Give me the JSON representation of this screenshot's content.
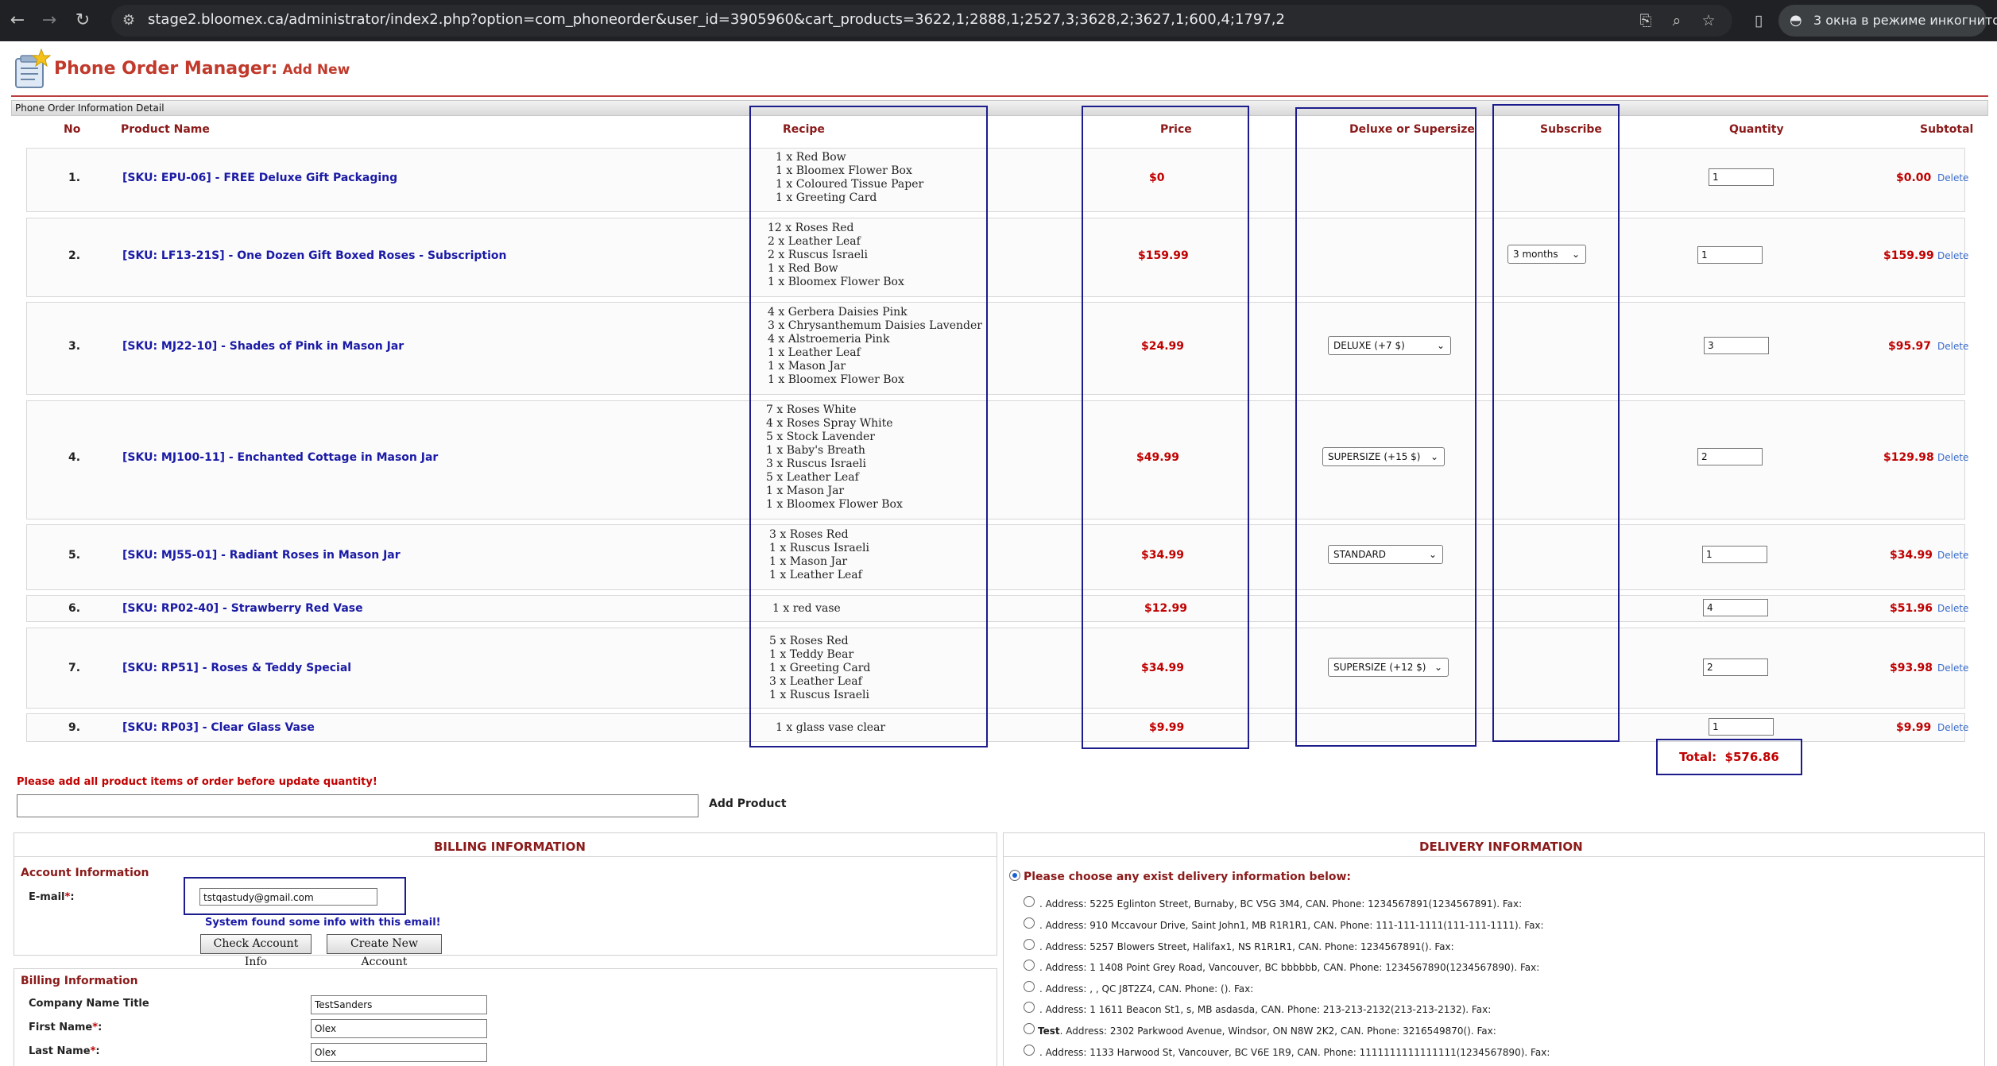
{
  "browser": {
    "url": "stage2.bloomex.ca/administrator/index2.php?option=com_phoneorder&user_id=3905960&cart_products=3622,1;2888,1;2527,3;3628,2;3627,1;600,4;1797,2",
    "incognito_label": "3 окна в режиме инкогнито"
  },
  "header": {
    "title": "Phone Order Manager:",
    "subtitle": "Add New",
    "section": "Phone Order Information Detail"
  },
  "table": {
    "headers": {
      "no": "No",
      "product": "Product Name",
      "recipe": "Recipe",
      "price": "Price",
      "deluxe": "Deluxe or Supersize",
      "subscribe": "Subscribe",
      "quantity": "Quantity",
      "subtotal": "Subtotal"
    },
    "delete_label": "Delete",
    "rows": [
      {
        "no": "1.",
        "name": "[SKU: EPU-06] - FREE Deluxe Gift Packaging",
        "recipe": [
          "1 x Red Bow",
          "1 x Bloomex Flower Box",
          "1 x Coloured Tissue Paper",
          "1 x Greeting Card"
        ],
        "price": "$0",
        "option": "",
        "subscribe": "",
        "qty": "1",
        "subtotal": "$0.00"
      },
      {
        "no": "2.",
        "name": "[SKU: LF13-21S] - One Dozen Gift Boxed Roses - Subscription",
        "recipe": [
          "12 x Roses Red",
          "2 x Leather Leaf",
          "2 x Ruscus Israeli",
          "1 x Red Bow",
          "1 x Bloomex Flower Box"
        ],
        "price": "$159.99",
        "option": "",
        "subscribe": "3 months",
        "qty": "1",
        "subtotal": "$159.99"
      },
      {
        "no": "3.",
        "name": "[SKU: MJ22-10] - Shades of Pink in Mason Jar",
        "recipe": [
          "4 x Gerbera Daisies Pink",
          "3 x Chrysanthemum Daisies Lavender",
          "4 x Alstroemeria Pink",
          "1 x Leather Leaf",
          "1 x Mason Jar",
          "1 x Bloomex Flower Box"
        ],
        "price": "$24.99",
        "option": "DELUXE (+7 $)",
        "subscribe": "",
        "qty": "3",
        "subtotal": "$95.97"
      },
      {
        "no": "4.",
        "name": "[SKU: MJ100-11] - Enchanted Cottage in Mason Jar",
        "recipe": [
          "7 x Roses White",
          "4 x Roses Spray White",
          "5 x Stock Lavender",
          "1 x Baby's Breath",
          "3 x Ruscus Israeli",
          "5 x Leather Leaf",
          "1 x Mason Jar",
          "1 x Bloomex Flower Box"
        ],
        "price": "$49.99",
        "option": "SUPERSIZE (+15 $)",
        "subscribe": "",
        "qty": "2",
        "subtotal": "$129.98"
      },
      {
        "no": "5.",
        "name": "[SKU: MJ55-01] - Radiant Roses in Mason Jar",
        "recipe": [
          "3 x Roses Red",
          "1 x Ruscus Israeli",
          "1 x Mason Jar",
          "1 x Leather Leaf"
        ],
        "price": "$34.99",
        "option": "STANDARD",
        "subscribe": "",
        "qty": "1",
        "subtotal": "$34.99"
      },
      {
        "no": "6.",
        "name": "[SKU: RP02-40] - Strawberry Red Vase",
        "recipe": [
          "1 x red vase"
        ],
        "price": "$12.99",
        "option": "",
        "subscribe": "",
        "qty": "4",
        "subtotal": "$51.96"
      },
      {
        "no": "7.",
        "name": "[SKU: RP51] - Roses & Teddy Special",
        "recipe": [
          "5 x Roses Red",
          "1 x Teddy Bear",
          "1 x Greeting Card",
          "3 x Leather Leaf",
          "1 x Ruscus Israeli"
        ],
        "price": "$34.99",
        "option": "SUPERSIZE (+12 $)",
        "subscribe": "",
        "qty": "2",
        "subtotal": "$93.98"
      },
      {
        "no": "9.",
        "name": "[SKU: RP03] - Clear Glass Vase",
        "recipe": [
          "1 x glass vase clear"
        ],
        "price": "$9.99",
        "option": "",
        "subscribe": "",
        "qty": "1",
        "subtotal": "$9.99"
      }
    ],
    "total_label": "Total:",
    "total_value": "$576.86"
  },
  "add_product": {
    "warning": "Please add all product items of order before update quantity!",
    "button": "Add Product"
  },
  "billing": {
    "title": "BILLING INFORMATION",
    "account_title": "Account Information",
    "email_label": "E-mail",
    "email_value": "tstqastudy@gmail.com",
    "found_msg": "System found some info with this email!",
    "check_btn": "Check Account Info",
    "create_btn": "Create New Account",
    "billing_title": "Billing Information",
    "company_label": "Company Name Title",
    "company_value": "TestSanders",
    "first_label": "First Name",
    "first_value": "Olex",
    "last_label": "Last Name",
    "last_value": "Olex"
  },
  "delivery": {
    "title": "DELIVERY INFORMATION",
    "choose": "Please choose any exist delivery information below:",
    "addresses": [
      {
        "name": "",
        "text": ". Address: 5225 Eglinton Street, Burnaby, BC V5G 3M4, CAN. Phone: 1234567891(1234567891). Fax:"
      },
      {
        "name": "",
        "text": ". Address: 910 Mccavour Drive, Saint John1, MB R1R1R1, CAN. Phone: 111-111-1111(111-111-1111). Fax:"
      },
      {
        "name": "",
        "text": ". Address: 5257 Blowers Street, Halifax1, NS R1R1R1, CAN. Phone: 1234567891(). Fax:"
      },
      {
        "name": "",
        "text": ". Address: 1 1408 Point Grey Road, Vancouver, BC bbbbbb, CAN. Phone: 1234567890(1234567890). Fax:"
      },
      {
        "name": "",
        "text": ". Address: , , QC J8T2Z4, CAN. Phone: (). Fax:"
      },
      {
        "name": "",
        "text": ". Address: 1 1611 Beacon St1, s, MB asdasda, CAN. Phone: 213-213-2132(213-213-2132). Fax:"
      },
      {
        "name": "Test",
        "text": ". Address: 2302 Parkwood Avenue, Windsor, ON N8W 2K2, CAN. Phone: 3216549870(). Fax:"
      },
      {
        "name": "",
        "text": ". Address: 1133 Harwood St, Vancouver, BC V6E 1R9, CAN. Phone: 1111111111111111(1234567890). Fax:"
      }
    ]
  }
}
